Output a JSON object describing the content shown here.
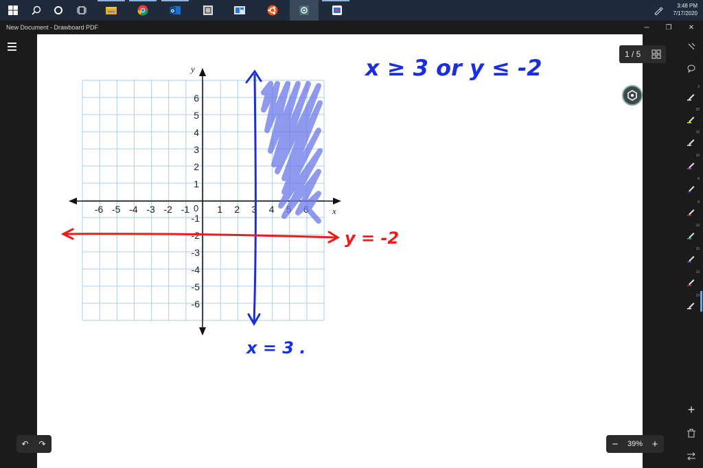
{
  "taskbar": {
    "apps": [
      "windows-start",
      "search",
      "cortana",
      "task-view",
      "file-explorer",
      "chrome",
      "outlook",
      "app-gray",
      "app-blue",
      "ubuntu",
      "drawboard-active",
      "paint-app"
    ],
    "time": "3:48 PM",
    "date": "7/17/2020"
  },
  "window": {
    "title": "New Document - Drawboard PDF",
    "minimize_glyph": "─",
    "maximize_glyph": "❐",
    "close_glyph": "✕"
  },
  "pager": {
    "label": "1 / 5"
  },
  "zoom": {
    "minus": "−",
    "value": "39%",
    "plus": "+"
  },
  "history": {
    "undo": "↶",
    "redo": "↷"
  },
  "rightrail": {
    "tool_sizes": [
      "2",
      "20",
      "10",
      "10",
      "8",
      "8",
      "10",
      "15",
      "19",
      "19"
    ],
    "add_glyph": "+",
    "tools": [
      "lasso-icon",
      "comment-icon",
      "pen-icon",
      "highlighter-icon",
      "pen-icon",
      "pen-icon",
      "pen-icon",
      "pen-icon",
      "pen-icon",
      "pen-icon",
      "pen-icon",
      "pen-icon"
    ]
  },
  "graph": {
    "x_ticks": [
      "-6",
      "-5",
      "-4",
      "-3",
      "-2",
      "-1",
      "1",
      "2",
      "3",
      "4",
      "5",
      "6"
    ],
    "y_ticks_pos": [
      "6",
      "5",
      "4",
      "3",
      "2",
      "1"
    ],
    "y_ticks_neg": [
      "-1",
      "-2",
      "-3",
      "-4",
      "-5",
      "-6"
    ],
    "origin": "0",
    "x_label": "x",
    "y_label": "y"
  },
  "handwriting": {
    "top_note": "x ≥ 3 or y ≤ -2",
    "red_line_label": "y = -2",
    "blue_line_label": "x = 3 ."
  },
  "colors": {
    "ink_blue": "#1a2ee0",
    "ink_red": "#ef1a1a",
    "shade_blue": "#6a78e8",
    "grid": "#aecde6"
  }
}
